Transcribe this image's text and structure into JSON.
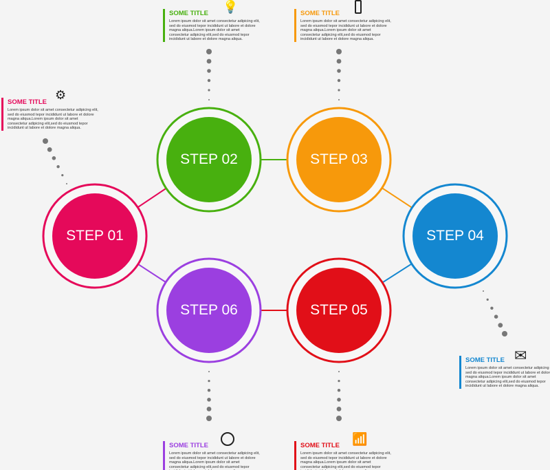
{
  "steps": [
    {
      "label": "STEP 01",
      "color": "#e5095a"
    },
    {
      "label": "STEP 02",
      "color": "#48b00f"
    },
    {
      "label": "STEP 03",
      "color": "#f7990b"
    },
    {
      "label": "STEP 04",
      "color": "#1487d0"
    },
    {
      "label": "STEP 05",
      "color": "#e10f18"
    },
    {
      "label": "STEP 06",
      "color": "#9b3fe0"
    }
  ],
  "blocks": [
    {
      "title": "SOME TITLE",
      "icon": "gears-icon",
      "color": "#e5095a",
      "body": "Lorem ipsum dolor sit amet consectetur adipicing elit, sed do eiusmod tepor incididunt ut labore et dolore magna aliqua.Lorem ipsum dolor sit amet consectetur adipicing elit,sed do eiusmod tepor incididunt ut labore et dolore magna aliqua."
    },
    {
      "title": "SOME TITLE",
      "icon": "lightbulb-icon",
      "color": "#48b00f",
      "body": "Lorem ipsum dolor sit amet consectetur adipicing elit, sed do eiusmod tepor incididunt ut labore et dolore magna aliqua.Lorem ipsum dolor sit amet consectetur adipicing elit,sed do eiusmod tepor incididunt ut labore et dolore magna aliqua."
    },
    {
      "title": "SOME TITLE",
      "icon": "smartphone-icon",
      "color": "#f7990b",
      "body": "Lorem ipsum dolor sit amet consectetur adipicing elit, sed do eiusmod tepor incididunt ut labore et dolore magna aliqua.Lorem ipsum dolor sit amet consectetur adipicing elit,sed do eiusmod tepor incididunt ut labore et dolore magna aliqua."
    },
    {
      "title": "SOME TITLE",
      "icon": "envelope-icon",
      "color": "#1487d0",
      "body": "Lorem ipsum dolor sit amet consectetur adipicing elit, sed do eiusmod tepor incididunt ut labore et dolore magna aliqua.Lorem ipsum dolor sit amet consectetur adipicing elit,sed do eiusmod tepor incididunt ut labore et dolore magna aliqua."
    },
    {
      "title": "SOME TITLE",
      "icon": "bar-chart-icon",
      "color": "#e10f18",
      "body": "Lorem ipsum dolor sit amet consectetur adipicing elit, sed do eiusmod tepor incididunt ut labore et dolore magna aliqua.Lorem ipsum dolor sit amet consectetur adipicing elit,sed do eiusmod tepor incididunt ut labore et dolore magna aliqua."
    },
    {
      "title": "SOME TITLE",
      "icon": "clock-icon",
      "color": "#9b3fe0",
      "body": "Lorem ipsum dolor sit amet consectetur adipicing elit, sed do eiusmod tepor incididunt ut labore et dolore magna aliqua.Lorem ipsum dolor sit amet consectetur adipicing elit,sed do eiusmod tepor incididunt ut labore et dolore magna aliqua."
    }
  ]
}
